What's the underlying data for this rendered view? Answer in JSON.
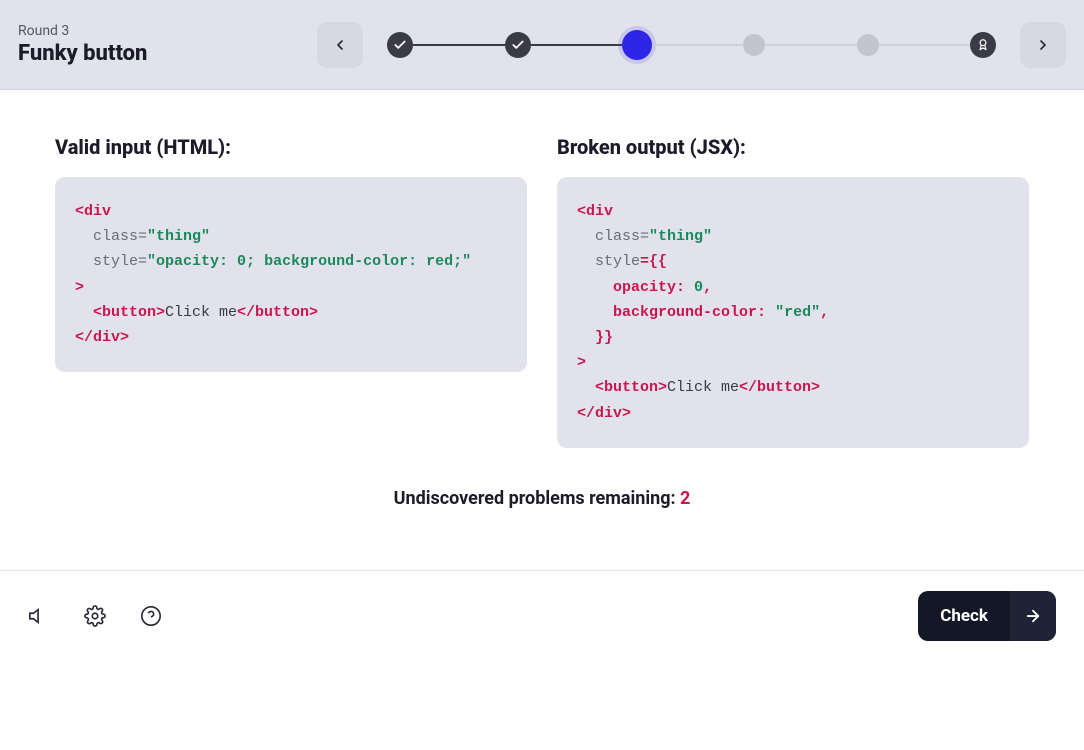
{
  "header": {
    "round_label": "Round 3",
    "title": "Funky button"
  },
  "left": {
    "heading": "Valid input (HTML):",
    "code": {
      "l1_tag": "<div",
      "l2_attr": "class",
      "l2_val": "\"thing\"",
      "l3_attr": "style",
      "l3_val": "\"opacity: 0; background-color: red;\"",
      "l4_close": ">",
      "l5_open": "<button>",
      "l5_text": "Click me",
      "l5_close": "</button>",
      "l6": "</div>"
    }
  },
  "right": {
    "heading": "Broken output (JSX):",
    "code": {
      "l1_tag": "<div",
      "l2_attr": "class",
      "l2_val": "\"thing\"",
      "l3_attr": "style",
      "l3_eq": "={{",
      "l4_prop": "opacity:",
      "l4_val": "0",
      "l4_comma": ",",
      "l5_prop": "background-color:",
      "l5_val": "\"red\"",
      "l5_comma": ",",
      "l6_close": "}}",
      "l7_close": ">",
      "l8_open": "<button>",
      "l8_text": "Click me",
      "l8_close": "</button>",
      "l9": "</div>"
    }
  },
  "remaining": {
    "label": "Undiscovered problems remaining: ",
    "count": "2"
  },
  "footer": {
    "check_label": "Check"
  }
}
